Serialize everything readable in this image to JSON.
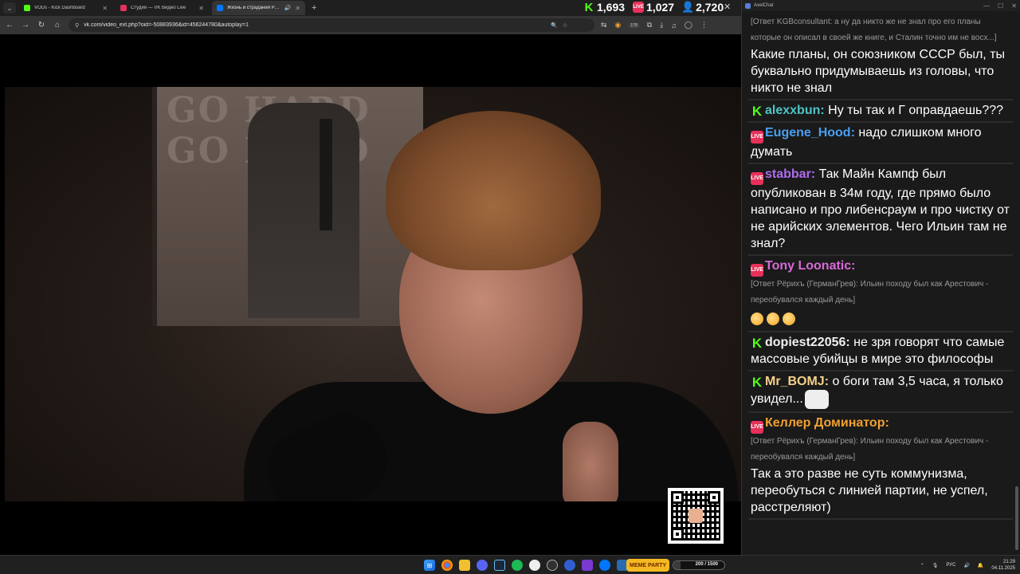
{
  "browser": {
    "tabs": [
      {
        "title": "VODs - Kick Dashboard",
        "favicon_color": "#53fc18",
        "active": false
      },
      {
        "title": "Студия — VK Видео Live",
        "favicon_color": "#e7305a",
        "active": false
      },
      {
        "title": "Жизнь и страдания Романа",
        "favicon_color": "#0077ff",
        "active": true
      }
    ],
    "url": "vk.com/video_ext.php?oid=-50883936&id=456244780&autoplay=1",
    "extension_badge": "178"
  },
  "stats": {
    "kick_viewers": "1,693",
    "vk_viewers": "1,027",
    "total_viewers": "2,720"
  },
  "video": {
    "poster_text": "GO HARD GO HARD"
  },
  "chat": {
    "window_title": "AxelChat",
    "top_partial": {
      "reply": "[Ответ KGBconsultant: а ну да никто же не знал про его планы которые он описал в своей же книге, и Сталин точно им не восх...]",
      "text": "Какие планы, он союзником СССР был, ты буквально придумываешь из головы, что никто не знал"
    },
    "messages": [
      {
        "platform": "kick",
        "user": "alexxbun",
        "color": "#4fc3c3",
        "text": "Ну ты так и Г оправдаешь???"
      },
      {
        "platform": "live",
        "user": "Eugene_Hood",
        "color": "#4a9ff0",
        "text": "надо слишком много думать"
      },
      {
        "platform": "live",
        "user": "stabbar",
        "color": "#b06cf0",
        "text": "Так Майн Кампф был опубликован в 34м году, где прямо было написано и про либенсраум и про чистку от не арийских элементов. Чего Ильин там не знал?"
      },
      {
        "platform": "live",
        "user": "Tony Loonatic",
        "color": "#d86ad8",
        "reply": "[Ответ Рёрихъ (ГерманГрев): Ильин походу был как Арестович - переобувался каждый день]",
        "text": "",
        "emotes": 3
      },
      {
        "platform": "kick",
        "user": "dopiest22056",
        "color": "#f0f0f0",
        "text": "не зря говорят что самые массовые убийцы в мире это философы"
      },
      {
        "platform": "kick",
        "user": "Mr_BOMJ",
        "color": "#f5d08a",
        "text": "о боги там 3,5 часа, я только увидел...",
        "big_emote": true
      },
      {
        "platform": "live",
        "user": "Келлер Доминатор",
        "color": "#f0a030",
        "reply": "[Ответ Рёрихъ (ГерманГрев): Ильин походу был как Арестович - переобувался каждый день]",
        "text": "Так а это разве не суть коммунизма, переобуться с линией партии, не успел, расстреляют)"
      }
    ]
  },
  "taskbar": {
    "meme_party_label": "MEME PARTY",
    "meme_progress_text": "200 / 1500",
    "meme_progress_fraction": 0.133,
    "language": "РУС",
    "time": "21:29",
    "date": "04.11.2025"
  }
}
